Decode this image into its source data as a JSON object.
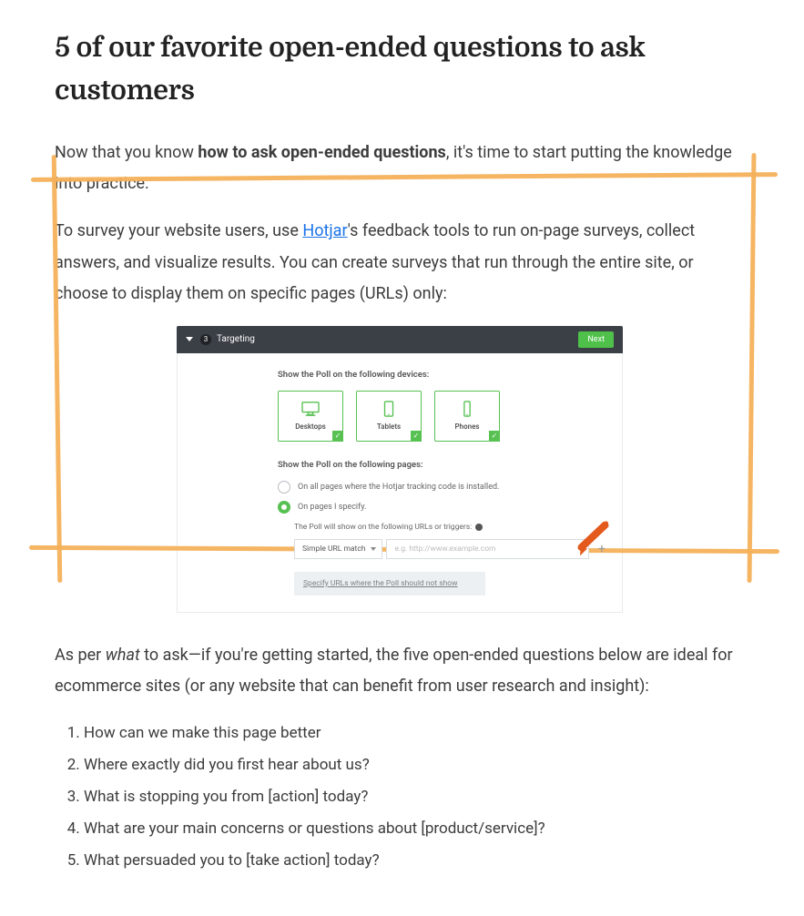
{
  "article": {
    "title": "5 of our favorite open-ended questions to ask customers",
    "p1_a": "Now that you know ",
    "p1_b_bold": "how to ask open-ended questions",
    "p1_c": ", it's time to start putting the knowledge into practice.",
    "p2_a": "To survey your website users, use ",
    "p2_link": "Hotjar",
    "p2_b": "'s feedback tools to run on-page surveys, collect answers, and visualize results. You can create surveys that run through the entire site, or choose to display them on specific pages (URLs) only:",
    "p3_a": "As per ",
    "p3_em": "what",
    "p3_b": " to ask—if you're getting started, the five open-ended questions below are ideal for ecommerce sites (or any website that can benefit from user research and insight):",
    "questions": [
      "How can we make this page better",
      "Where exactly did you first hear about us?",
      "What is stopping you from [action] today?",
      "What are your main concerns or questions about [product/service]?",
      "What persuaded you to [take action] today?"
    ]
  },
  "panel": {
    "head_badge": "3",
    "head_title": "Targeting",
    "head_next": "Next",
    "devices_label": "Show the Poll on the following devices:",
    "devices": [
      "Desktops",
      "Tablets",
      "Phones"
    ],
    "pages_label": "Show the Poll on the following pages:",
    "radio_all": "On all pages where the Hotjar tracking code is installed.",
    "radio_specific": "On pages I specify.",
    "trigger_label": "The Poll will show on the following URLs or triggers:",
    "select_value": "Simple URL match",
    "url_placeholder": "e.g. http://www.example.com",
    "exclude_link": "Specify URLs where the Poll should not show"
  }
}
